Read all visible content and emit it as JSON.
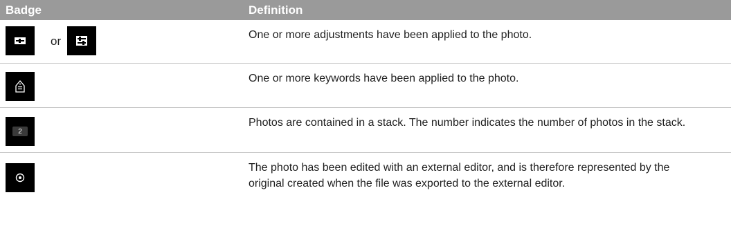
{
  "header": {
    "badge": "Badge",
    "definition": "Definition"
  },
  "rows": [
    {
      "icon": "adjustments-icon",
      "or_label": "or",
      "definition": "One or more adjustments have been applied to the photo."
    },
    {
      "icon": "keyword-tag-icon",
      "definition": "One or more keywords have been applied to the photo."
    },
    {
      "icon": "stack-count-icon",
      "stack_number": "2",
      "definition": "Photos are contained in a stack. The number indicates the number of photos in the stack."
    },
    {
      "icon": "external-editor-icon",
      "definition": "The photo has been edited with an external editor, and is therefore represented by the original created when the file was exported to the external editor."
    }
  ]
}
